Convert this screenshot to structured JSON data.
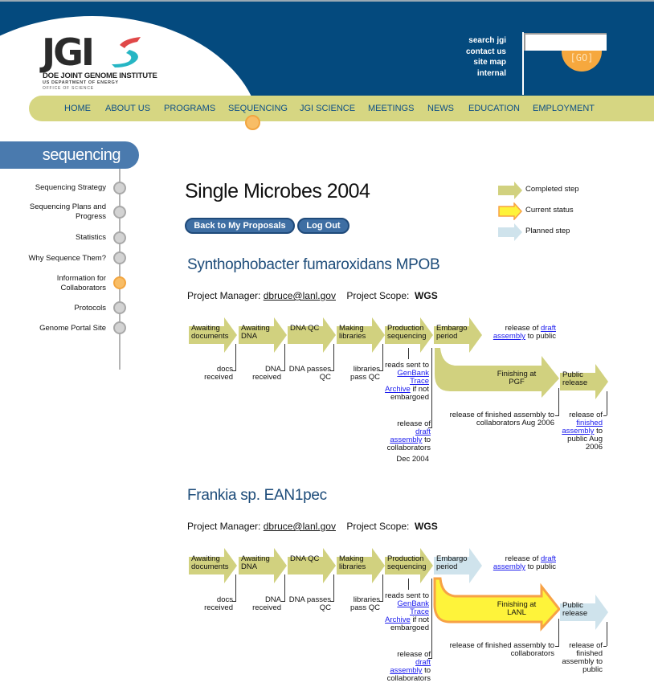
{
  "header": {
    "logo": {
      "wordmark": "JGI",
      "line1": "DOE JOINT GENOME INSTITUTE",
      "line2": "US DEPARTMENT OF ENERGY",
      "line3": "OFFICE OF SCIENCE"
    },
    "utility_links": [
      "search jgi",
      "contact us",
      "site map",
      "internal"
    ],
    "search": {
      "value": "",
      "placeholder": ""
    },
    "go_label": "[GO]"
  },
  "nav": {
    "items": [
      "HOME",
      "ABOUT US",
      "PROGRAMS",
      "SEQUENCING",
      "JGI SCIENCE",
      "MEETINGS",
      "NEWS",
      "EDUCATION",
      "EMPLOYMENT"
    ],
    "active": "SEQUENCING"
  },
  "sidebar": {
    "section_title": "sequencing",
    "items": [
      {
        "label": "Sequencing Strategy",
        "active": false
      },
      {
        "label": "Sequencing Plans and Progress",
        "active": false
      },
      {
        "label": "Statistics",
        "active": false
      },
      {
        "label": "Why Sequence Them?",
        "active": false
      },
      {
        "label": "Information for Collaborators",
        "active": true
      },
      {
        "label": "Protocols",
        "active": false
      },
      {
        "label": "Genome Portal Site",
        "active": false
      }
    ]
  },
  "main": {
    "title": "Single Microbes 2004",
    "buttons": {
      "back": "Back to My Proposals",
      "logout": "Log Out"
    },
    "legend": [
      {
        "label": "Completed step",
        "status": "completed"
      },
      {
        "label": "Current status",
        "status": "current"
      },
      {
        "label": "Planned step",
        "status": "planned"
      }
    ],
    "status_colors": {
      "completed": "#d1d17f",
      "current": "#fef33a",
      "current_border": "#f7a245",
      "planned": "#cfe3ec"
    },
    "projects": [
      {
        "name": "Synthophobacter fumaroxidans MPOB",
        "manager_label": "Project Manager:",
        "manager": "dbruce@lanl.gov",
        "scope_label": "Project Scope:",
        "scope": "WGS",
        "stages": [
          {
            "label": "Awaiting documents",
            "status": "completed"
          },
          {
            "label": "Awaiting DNA",
            "status": "completed"
          },
          {
            "label": "DNA QC",
            "status": "completed"
          },
          {
            "label": "Making libraries",
            "status": "completed"
          },
          {
            "label": "Production sequencing",
            "status": "completed"
          },
          {
            "label": "Embargo period",
            "status": "completed"
          },
          {
            "label": "Finishing at PGF",
            "status": "completed"
          },
          {
            "label": "Public release",
            "status": "completed"
          }
        ],
        "notes": {
          "docs": "docs received",
          "dna": "DNA received",
          "dnaqc": "DNA passes QC",
          "libs": "libraries pass QC",
          "reads_pre": "reads sent to ",
          "reads_link": "GenBank Trace Archive",
          "reads_post": " if not embargoed",
          "draft_pre": "release of ",
          "draft_link": "draft assembly",
          "draft_post": " to collaborators",
          "draft_date": "Dec 2004",
          "public_draft_pre": "release of ",
          "public_draft_link1": "draft",
          "public_draft_link2": "assembly",
          "public_draft_post": " to public",
          "finished_collab": "release of finished assembly to collaborators Aug 2006",
          "finished_public_pre": "release of ",
          "finished_public_link": "finished assembly",
          "finished_public_post": " to public Aug 2006"
        }
      },
      {
        "name": "Frankia sp. EAN1pec",
        "manager_label": "Project Manager:",
        "manager": "dbruce@lanl.gov",
        "scope_label": "Project Scope:",
        "scope": "WGS",
        "stages": [
          {
            "label": "Awaiting documents",
            "status": "completed"
          },
          {
            "label": "Awaiting DNA",
            "status": "completed"
          },
          {
            "label": "DNA QC",
            "status": "completed"
          },
          {
            "label": "Making libraries",
            "status": "completed"
          },
          {
            "label": "Production sequencing",
            "status": "completed"
          },
          {
            "label": "Embargo period",
            "status": "planned"
          },
          {
            "label": "Finishing at LANL",
            "status": "current"
          },
          {
            "label": "Public release",
            "status": "planned"
          }
        ],
        "notes": {
          "docs": "docs received",
          "dna": "DNA received",
          "dnaqc": "DNA passes QC",
          "libs": "libraries pass QC",
          "reads_pre": "reads sent to ",
          "reads_link": "GenBank Trace Archive",
          "reads_post": " if not embargoed",
          "draft_pre": "release of ",
          "draft_link": "draft assembly",
          "draft_post": " to collaborators",
          "draft_date": "",
          "public_draft_pre": "release of ",
          "public_draft_link1": "draft",
          "public_draft_link2": "assembly",
          "public_draft_post": " to public",
          "finished_collab": "release of finished assembly to collaborators",
          "finished_public_pre": "release of finished assembly to public",
          "finished_public_link": "",
          "finished_public_post": ""
        }
      }
    ]
  }
}
